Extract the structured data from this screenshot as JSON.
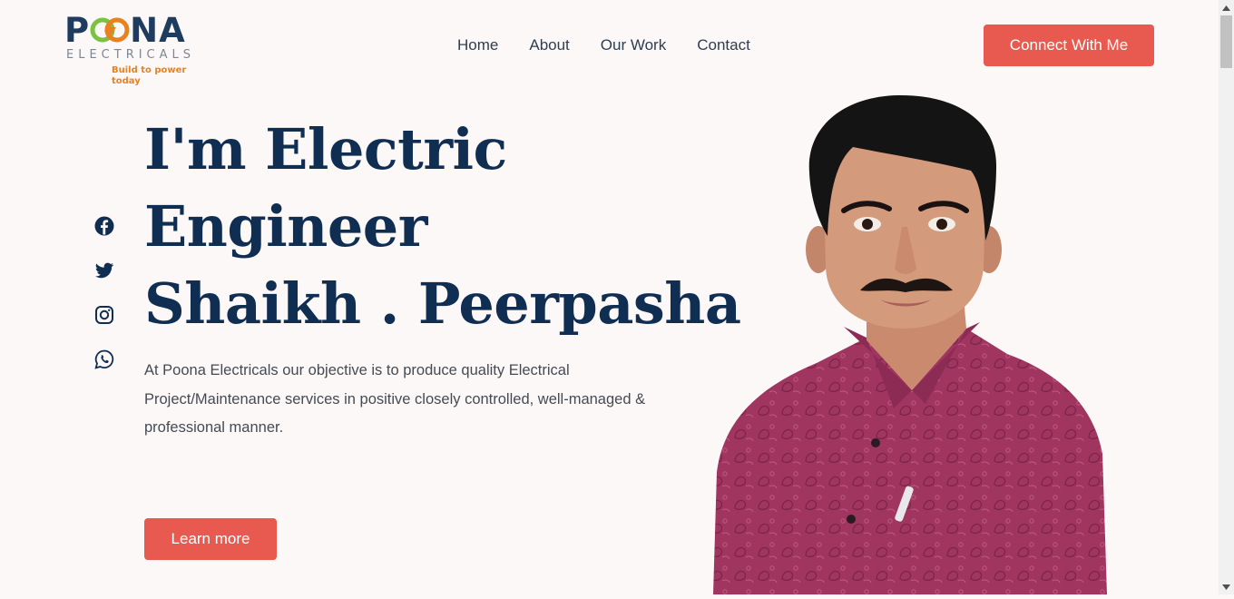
{
  "brand": {
    "name_part1": "P",
    "name_part2": "NA",
    "sub": "ELECTRICALS",
    "tagline": "Build to power today",
    "colors": {
      "primary": "#1f3c5f",
      "accent_orange": "#e8821f",
      "accent_green": "#7cc242"
    }
  },
  "nav": {
    "items": [
      {
        "label": "Home"
      },
      {
        "label": "About"
      },
      {
        "label": "Our Work"
      },
      {
        "label": "Contact"
      }
    ],
    "cta_label": "Connect With Me"
  },
  "social": [
    {
      "icon": "facebook-icon"
    },
    {
      "icon": "twitter-icon"
    },
    {
      "icon": "instagram-icon"
    },
    {
      "icon": "whatsapp-icon"
    }
  ],
  "hero": {
    "line1": "I'm Electric",
    "line2": "Engineer",
    "line3": "Shaikh . Peerpasha",
    "description": "At Poona Electricals our objective is to produce quality Electrical Project/Maintenance services in positive closely controlled, well-managed & professional manner.",
    "button_label": "Learn more"
  },
  "theme": {
    "accent": "#e85a4f",
    "heading": "#0f2e52",
    "background": "#fdf8f8"
  }
}
